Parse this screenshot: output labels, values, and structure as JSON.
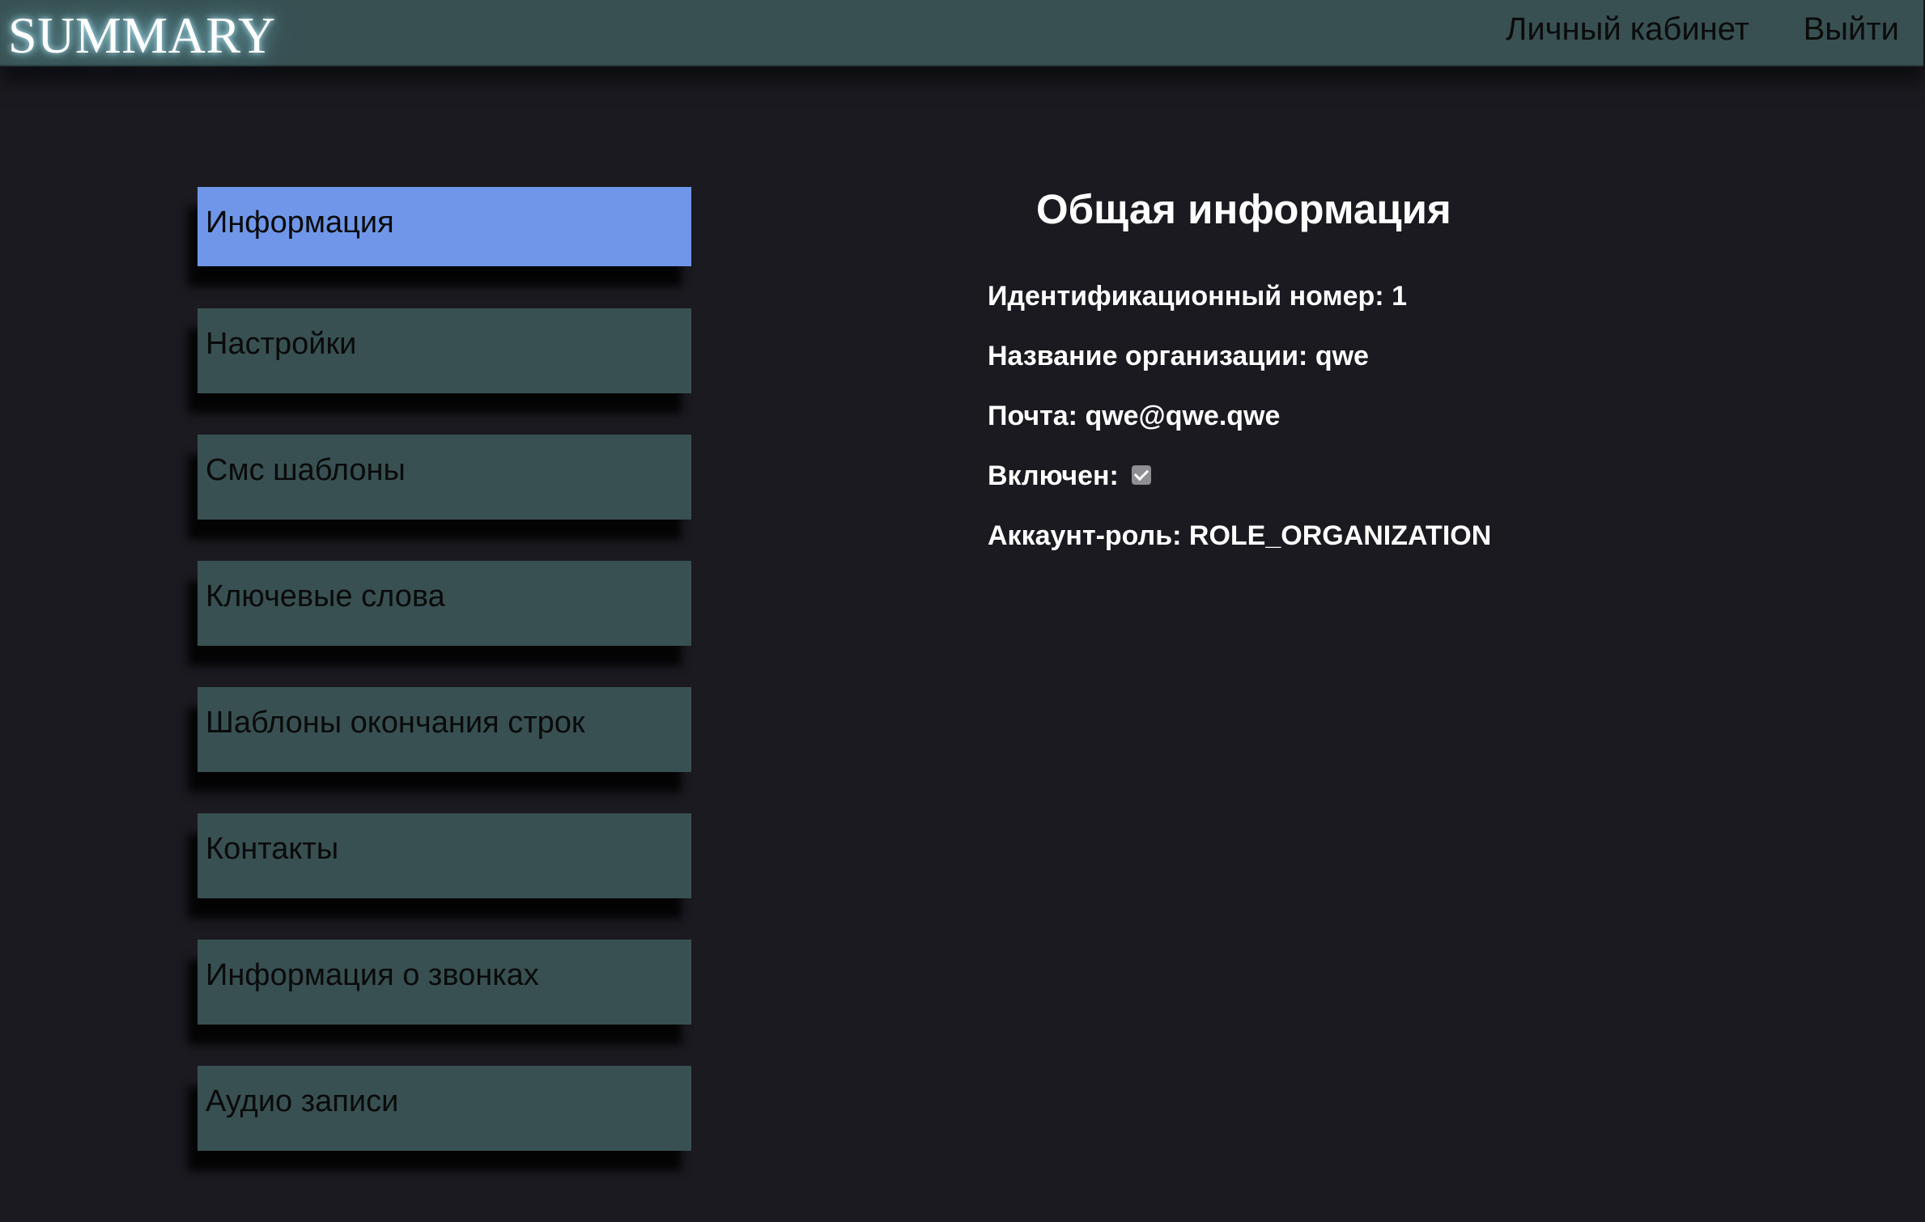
{
  "header": {
    "logo": "SUMMARY",
    "nav": {
      "cabinet": "Личный кабинет",
      "logout": "Выйти"
    }
  },
  "sidebar": {
    "items": [
      {
        "label": "Информация",
        "active": true
      },
      {
        "label": "Настройки",
        "active": false
      },
      {
        "label": "Смс шаблоны",
        "active": false
      },
      {
        "label": "Ключевые слова",
        "active": false
      },
      {
        "label": "Шаблоны окончания строк",
        "active": false
      },
      {
        "label": "Контакты",
        "active": false
      },
      {
        "label": "Информация о звонках",
        "active": false
      },
      {
        "label": "Аудио записи",
        "active": false
      }
    ]
  },
  "main": {
    "title": "Общая информация",
    "id": {
      "label": "Идентификационный номер:",
      "value": "1"
    },
    "org": {
      "label": "Название организации:",
      "value": "qwe"
    },
    "email": {
      "label": "Почта:",
      "value": "qwe@qwe.qwe"
    },
    "enabled": {
      "label": "Включен:",
      "checked": true
    },
    "role": {
      "label": "Аккаунт-роль:",
      "value": "ROLE_ORGANIZATION"
    }
  },
  "colors": {
    "background": "#1b1a20",
    "header": "#385052",
    "sidebar_item": "#385052",
    "sidebar_active": "#6f96e8",
    "text_light": "#ffffff",
    "text_dark": "#0a0a0a"
  }
}
